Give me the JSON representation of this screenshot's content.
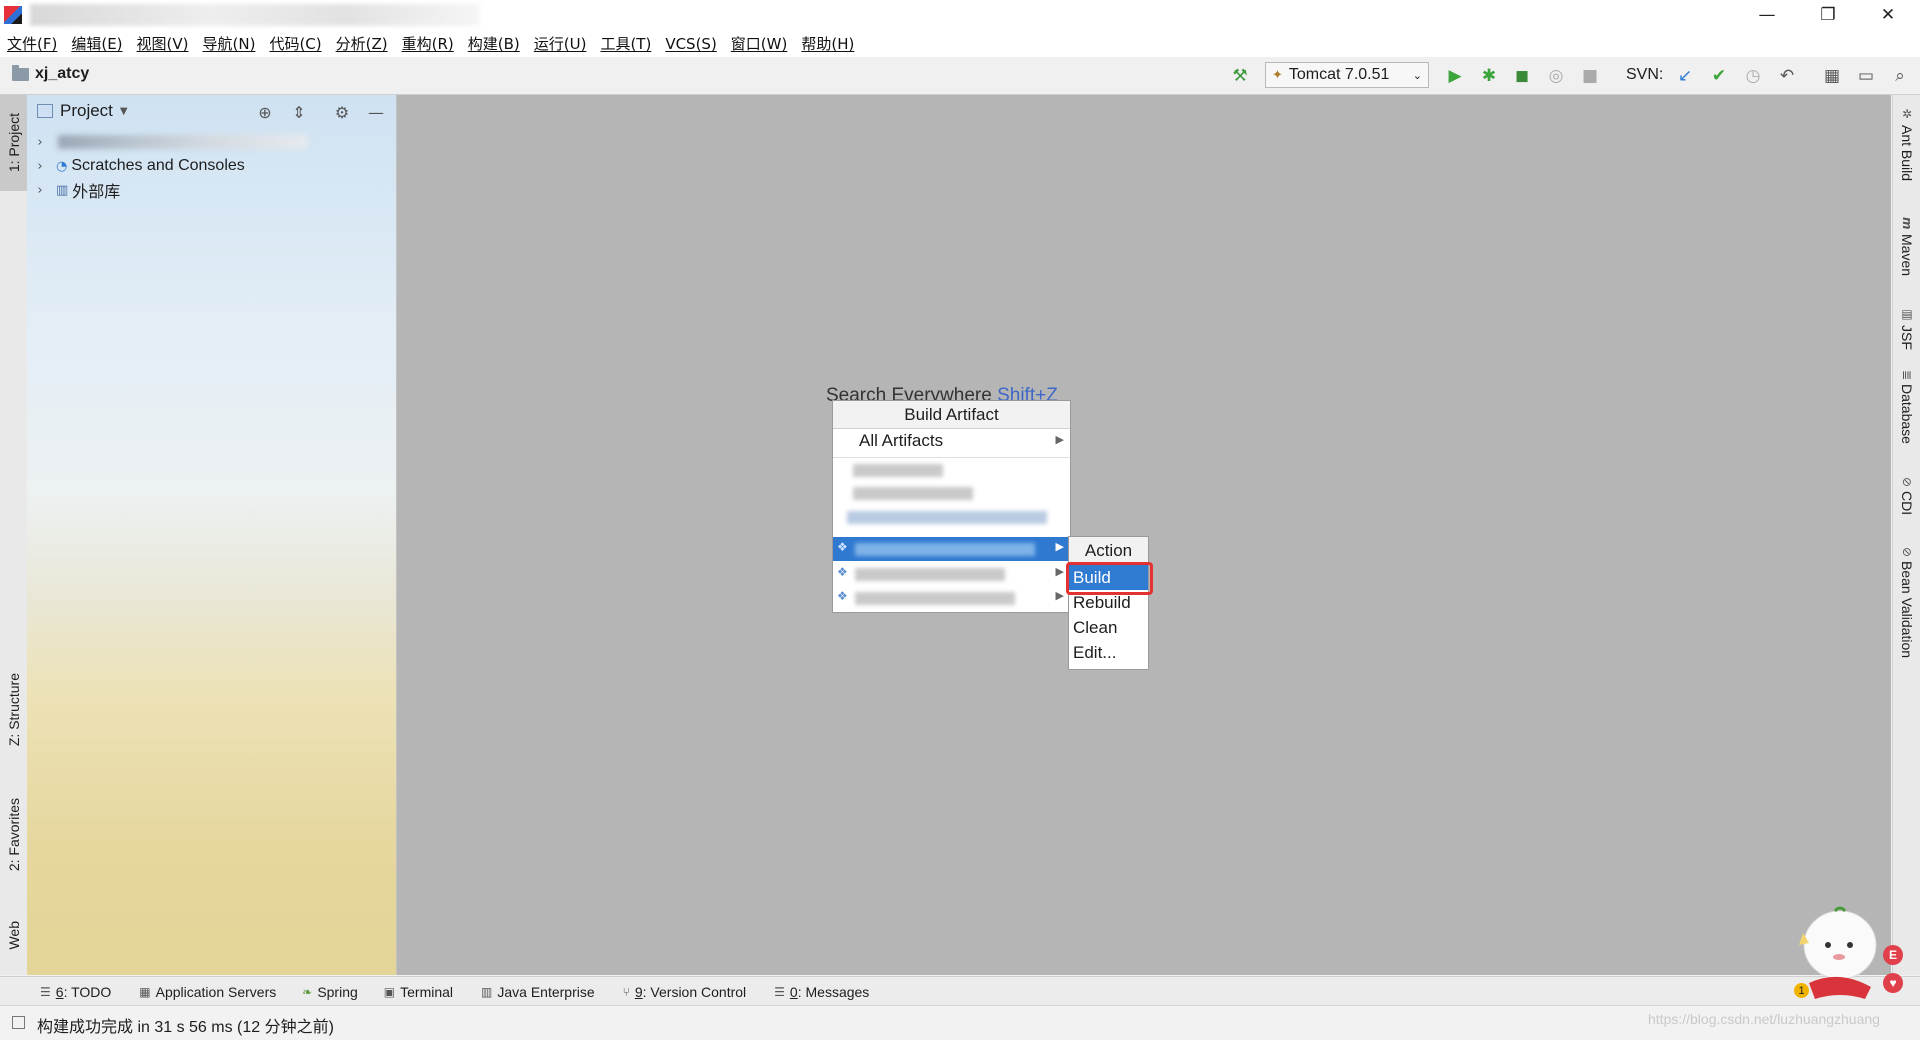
{
  "window": {
    "min_glyph": "—",
    "restore_glyph": "❐",
    "close_glyph": "✕"
  },
  "menu": [
    "文件(F)",
    "编辑(E)",
    "视图(V)",
    "导航(N)",
    "代码(C)",
    "分析(Z)",
    "重构(R)",
    "构建(B)",
    "运行(U)",
    "工具(T)",
    "VCS(S)",
    "窗口(W)",
    "帮助(H)"
  ],
  "navbar": {
    "project_name": "xj_atcy",
    "run_config": "Tomcat 7.0.51",
    "svn_label": "SVN:"
  },
  "left_tabs": {
    "project": "1: Project",
    "structure": "Z: Structure",
    "favorites": "2: Favorites",
    "web": "Web"
  },
  "project_panel": {
    "title": "Project",
    "tree": [
      {
        "label": "",
        "redacted": true
      },
      {
        "label": "Scratches and Consoles"
      },
      {
        "label": "外部库"
      }
    ]
  },
  "editor": {
    "search_hint": "Search Everywhere",
    "search_shortcut": "Shift+Z"
  },
  "build_artifact_popup": {
    "title": "Build Artifact",
    "all_artifacts": "All Artifacts"
  },
  "action_popup": {
    "title": "Action",
    "items": [
      "Build",
      "Rebuild",
      "Clean",
      "Edit..."
    ]
  },
  "right_tabs": [
    "Ant Build",
    "Maven",
    "JSF",
    "Database",
    "CDI",
    "Bean Validation"
  ],
  "bottom_tools": [
    {
      "num": "6",
      "label": ": TODO"
    },
    {
      "num": "",
      "label": "Application Servers"
    },
    {
      "num": "",
      "label": "Spring"
    },
    {
      "num": "",
      "label": "Terminal"
    },
    {
      "num": "",
      "label": "Java Enterprise"
    },
    {
      "num": "9",
      "label": ": Version Control"
    },
    {
      "num": "0",
      "label": ": Messages"
    }
  ],
  "status": {
    "message": "构建成功完成 in 31 s 56 ms (12 分钟之前)",
    "event_count": "1",
    "watermark": "https://blog.csdn.net/luzhuangzhuang"
  },
  "colors": {
    "selection": "#2f79d0",
    "highlight_box": "#e43232",
    "editor_bg": "#b5b5b5"
  }
}
